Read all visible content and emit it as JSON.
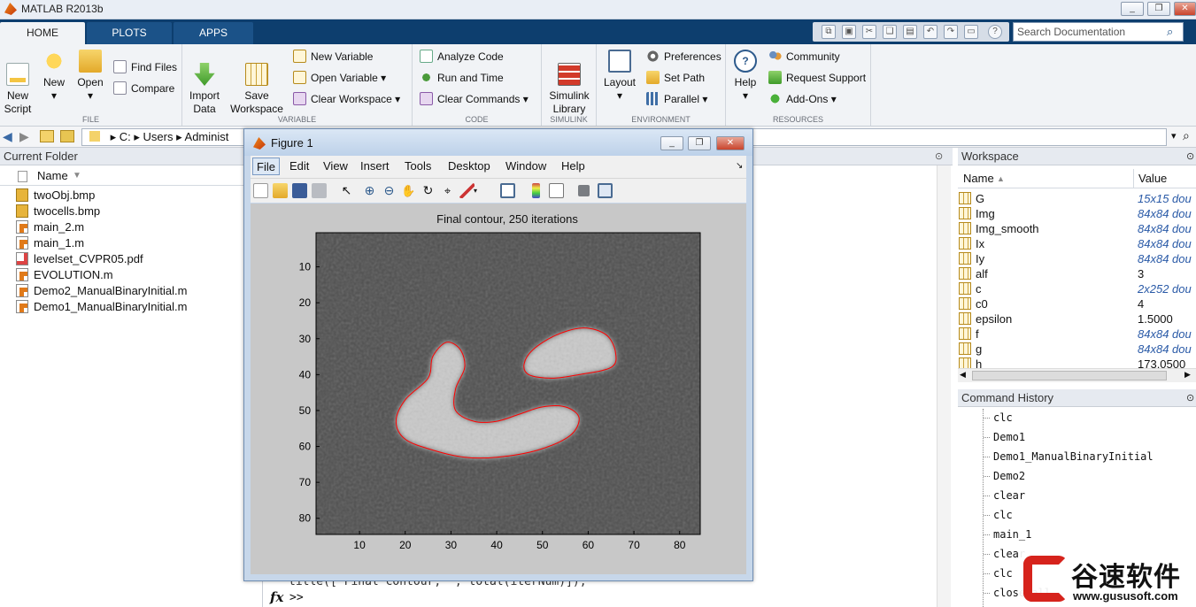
{
  "window": {
    "title": "MATLAB R2013b"
  },
  "tabs": [
    {
      "label": "HOME"
    },
    {
      "label": "PLOTS"
    },
    {
      "label": "APPS"
    }
  ],
  "search": {
    "placeholder": "Search Documentation"
  },
  "ribbon": {
    "file": {
      "label": "FILE",
      "new_script": "New\nScript",
      "new": "New",
      "open": "Open",
      "find_files": "Find Files",
      "compare": "Compare"
    },
    "variable": {
      "label": "VARIABLE",
      "import_data": "Import\nData",
      "save_workspace": "Save\nWorkspace",
      "new_variable": "New Variable",
      "open_variable": "Open Variable",
      "clear_workspace": "Clear Workspace"
    },
    "code": {
      "label": "CODE",
      "analyze_code": "Analyze Code",
      "run_and_time": "Run and Time",
      "clear_commands": "Clear Commands"
    },
    "simulink": {
      "label": "SIMULINK",
      "simulink_library": "Simulink\nLibrary"
    },
    "environment": {
      "label": "ENVIRONMENT",
      "layout": "Layout",
      "preferences": "Preferences",
      "set_path": "Set Path",
      "parallel": "Parallel"
    },
    "resources": {
      "label": "RESOURCES",
      "help": "Help",
      "community": "Community",
      "request_support": "Request Support",
      "add_ons": "Add-Ons"
    }
  },
  "address": {
    "path": [
      "C:",
      "Users",
      "Administ"
    ]
  },
  "current_folder": {
    "title": "Current Folder",
    "column": "Name",
    "files": [
      {
        "name": "twoObj.bmp",
        "type": "bmp"
      },
      {
        "name": "twocells.bmp",
        "type": "bmp"
      },
      {
        "name": "main_2.m",
        "type": "m"
      },
      {
        "name": "main_1.m",
        "type": "m"
      },
      {
        "name": "levelset_CVPR05.pdf",
        "type": "pdf"
      },
      {
        "name": "EVOLUTION.m",
        "type": "m"
      },
      {
        "name": "Demo2_ManualBinaryInitial.m",
        "type": "m"
      },
      {
        "name": "Demo1_ManualBinaryInitial.m",
        "type": "m"
      }
    ]
  },
  "command_window": {
    "partial_line": "title(['Final contour, ', total(iterNum)]);",
    "fx": "fx",
    "prompt": ">>"
  },
  "workspace": {
    "title": "Workspace",
    "col_name": "Name",
    "col_value": "Value",
    "vars": [
      {
        "name": "G",
        "value": "15x15 dou",
        "italic": true
      },
      {
        "name": "Img",
        "value": "84x84 dou",
        "italic": true
      },
      {
        "name": "Img_smooth",
        "value": "84x84 dou",
        "italic": true
      },
      {
        "name": "Ix",
        "value": "84x84 dou",
        "italic": true
      },
      {
        "name": "Iy",
        "value": "84x84 dou",
        "italic": true
      },
      {
        "name": "alf",
        "value": "3",
        "italic": false
      },
      {
        "name": "c",
        "value": "2x252 dou",
        "italic": true
      },
      {
        "name": "c0",
        "value": "4",
        "italic": false
      },
      {
        "name": "epsilon",
        "value": "1.5000",
        "italic": false
      },
      {
        "name": "f",
        "value": "84x84 dou",
        "italic": true
      },
      {
        "name": "g",
        "value": "84x84 dou",
        "italic": true
      },
      {
        "name": "h",
        "value": "173.0500",
        "italic": false
      }
    ]
  },
  "command_history": {
    "title": "Command History",
    "items": [
      "clc",
      "Demo1",
      "Demo1_ManualBinaryInitial",
      "Demo2",
      "clear",
      "clc",
      "main_1",
      "clear",
      "clc",
      "close all"
    ]
  },
  "figure": {
    "title": "Figure 1",
    "menu": [
      "File",
      "Edit",
      "View",
      "Insert",
      "Tools",
      "Desktop",
      "Window",
      "Help"
    ],
    "plot_title": "Final contour, 250 iterations",
    "xticks": [
      "10",
      "20",
      "30",
      "40",
      "50",
      "60",
      "70",
      "80"
    ],
    "yticks": [
      "10",
      "20",
      "30",
      "40",
      "50",
      "60",
      "70",
      "80"
    ]
  },
  "chart_data": {
    "type": "heatmap",
    "title": "Final contour, 250 iterations",
    "xlim": [
      0.5,
      84.5
    ],
    "ylim": [
      0.5,
      84.5
    ],
    "y_direction": "reversed",
    "colormap": "gray",
    "contour_color": "#ff0000",
    "objects": [
      {
        "name": "blob",
        "contour": [
          [
            46,
            37
          ],
          [
            48,
            33
          ],
          [
            53,
            29
          ],
          [
            59,
            27
          ],
          [
            64,
            29
          ],
          [
            66,
            34
          ],
          [
            65,
            38
          ],
          [
            58,
            40
          ],
          [
            52,
            41
          ],
          [
            47,
            40
          ]
        ]
      },
      {
        "name": "curved-cell",
        "contour": [
          [
            29,
            31
          ],
          [
            32,
            33
          ],
          [
            33,
            38
          ],
          [
            31,
            44
          ],
          [
            31,
            50
          ],
          [
            35,
            53
          ],
          [
            40,
            53
          ],
          [
            45,
            51
          ],
          [
            50,
            49
          ],
          [
            55,
            49
          ],
          [
            58,
            52
          ],
          [
            56,
            57
          ],
          [
            49,
            61
          ],
          [
            40,
            63
          ],
          [
            33,
            63
          ],
          [
            26,
            61
          ],
          [
            20,
            58
          ],
          [
            18,
            53
          ],
          [
            20,
            47
          ],
          [
            25,
            41
          ],
          [
            26,
            35
          ]
        ]
      }
    ]
  },
  "watermark": {
    "brand": "谷速软件",
    "url": "www.gususoft.com"
  }
}
